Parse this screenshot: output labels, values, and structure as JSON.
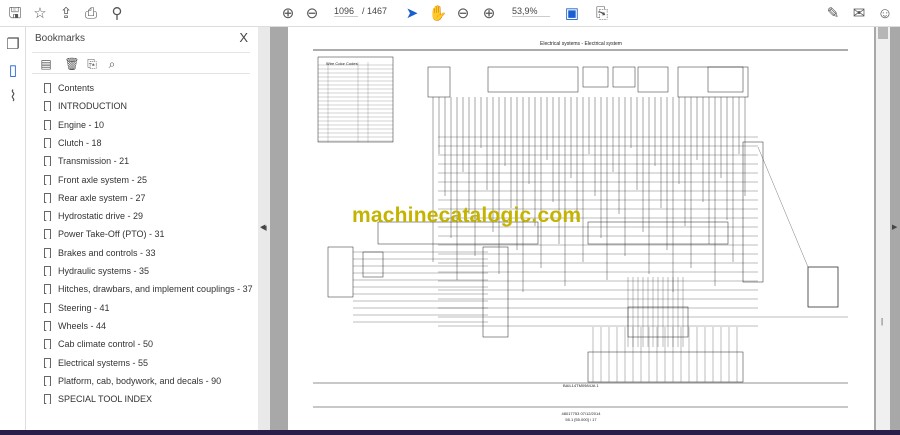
{
  "toolbar": {
    "page_current": "1096",
    "page_total": "/ 1467",
    "zoom": "53,9%",
    "icons": [
      "save-icon",
      "star-icon",
      "upload-icon",
      "print-icon",
      "search-icon",
      "page-up-icon",
      "page-down-icon",
      "select-arrow-icon",
      "hand-icon",
      "zoom-out-icon",
      "zoom-in-icon",
      "fit-page-icon",
      "scroll-mode-icon",
      "sign-icon",
      "mail-icon",
      "account-icon"
    ]
  },
  "panel": {
    "title": "Bookmarks",
    "close": "X"
  },
  "bookmarks": [
    "Contents",
    "INTRODUCTION",
    "Engine - 10",
    "Clutch - 18",
    "Transmission - 21",
    "Front axle system - 25",
    "Rear axle system - 27",
    "Hydrostatic drive - 29",
    "Power Take-Off (PTO) - 31",
    "Brakes and controls - 33",
    "Hydraulic systems - 35",
    "Hitches, drawbars, and implement couplings - 37",
    "Steering - 41",
    "Wheels - 44",
    "Cab climate control - 50",
    "Electrical systems - 55",
    "Platform, cab, bodywork, and decals - 90",
    "SPECIAL TOOL INDEX"
  ],
  "document": {
    "header": "Electrical systems - Electrical system",
    "table_title": "Wire Color Codes",
    "figure_ref": "BAIL14TM0984JA 1",
    "footer_code": "48017753 07/12/2014",
    "footer_page": "55.1 [55.000] / 17",
    "watermark": "machinecatalogic.com"
  }
}
